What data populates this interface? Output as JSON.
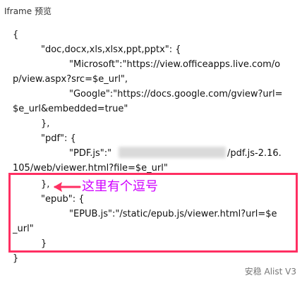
{
  "header": {
    "title": "Iframe 预览"
  },
  "code": {
    "lines": [
      "{",
      "\"doc,docx,xls,xlsx,ppt,pptx\": {",
      "\"Microsoft\":\"https://view.officeapps.live.com/o",
      "p/view.aspx?src=$e_url\",",
      "\"Google\":\"https://docs.google.com/gview?url=",
      "$e_url&embedded=true\"",
      "},",
      "\"pdf\": {",
      "\"PDF.js\":\"",
      "/pdf.js-2.16.",
      "105/web/viewer.html?file=$e_url\"",
      "},",
      "\"epub\": {",
      "\"EPUB.js\":\"/static/epub.js/viewer.html?url=$e",
      "_url\"",
      "}",
      "}"
    ]
  },
  "annotation": {
    "text": "这里有个逗号",
    "color": "#d000ff",
    "border_color": "#ff2f62"
  },
  "footer": {
    "text": "安稳 Alist V3"
  }
}
